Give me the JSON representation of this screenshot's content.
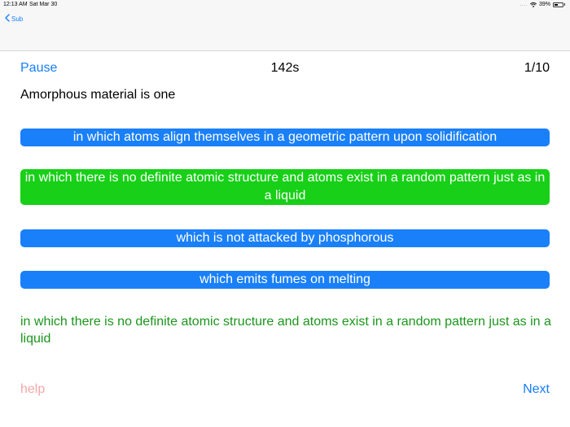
{
  "status_bar": {
    "time": "12:13 AM",
    "date": "Sat Mar 30",
    "signal": "....",
    "battery_text": "39%",
    "battery_level": 0.39
  },
  "nav": {
    "back_label": "Sub"
  },
  "quiz": {
    "pause_label": "Pause",
    "timer": "142s",
    "progress": "1/10",
    "question": "Amorphous material is one",
    "options": [
      {
        "text": "in which atoms align themselves in a geometric pattern upon solidification",
        "state": "normal"
      },
      {
        "text": "in which there is no definite atomic structure and atoms exist in a random pattern just as in a liquid",
        "state": "correct"
      },
      {
        "text": "which is not attacked by phosphorous",
        "state": "normal"
      },
      {
        "text": "which emits fumes on melting",
        "state": "normal"
      }
    ],
    "answer_text": " in which there is no definite atomic structure and atoms exist in a random pattern just as in a liquid",
    "help_label": "help",
    "next_label": "Next"
  },
  "colors": {
    "accent": "#157efb",
    "option_blue": "#1a80f9",
    "option_correct": "#17d017",
    "answer_text": "#1b961b",
    "help_text": "#f4a6a6"
  }
}
